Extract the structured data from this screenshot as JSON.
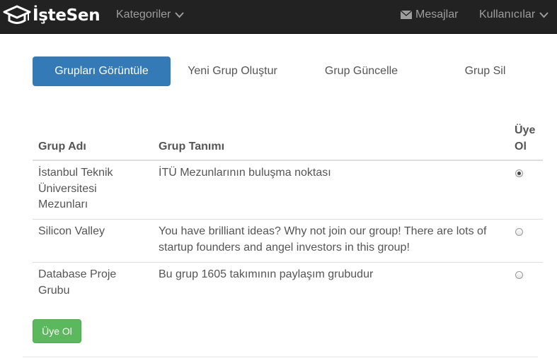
{
  "navbar": {
    "brand": "İşteSen",
    "categories": "Kategoriler",
    "messages": "Mesajlar",
    "users": "Kullanıcılar"
  },
  "tabs": [
    {
      "label": "Grupları Görüntüle",
      "active": true
    },
    {
      "label": "Yeni Grup Oluştur",
      "active": false
    },
    {
      "label": "Grup Güncelle",
      "active": false
    },
    {
      "label": "Grup Sil",
      "active": false
    }
  ],
  "table": {
    "headers": {
      "name": "Grup Adı",
      "description": "Grup Tanımı",
      "join_line1": "Üye",
      "join_line2": "Ol"
    },
    "rows": [
      {
        "name_lines": [
          "İstanbul Teknik",
          "Üniversitesi",
          "Mezunları"
        ],
        "description_lines": [
          "İTÜ Mezunlarının buluşma noktası"
        ],
        "selected": true
      },
      {
        "name_lines": [
          "Silicon Valley"
        ],
        "description_lines": [
          "You have brilliant ideas? Why not join our group! There are lots of",
          "startup founders and angel investors in this group!"
        ],
        "selected": false
      },
      {
        "name_lines": [
          "Database Proje",
          "Grubu"
        ],
        "description_lines": [
          "Bu grup 1605 takımının paylaşım grubudur"
        ],
        "selected": false
      }
    ]
  },
  "join_button": "Üye Ol",
  "colors": {
    "navbar_bg": "#222222",
    "primary": "#337ab7",
    "success": "#5cb85c"
  }
}
